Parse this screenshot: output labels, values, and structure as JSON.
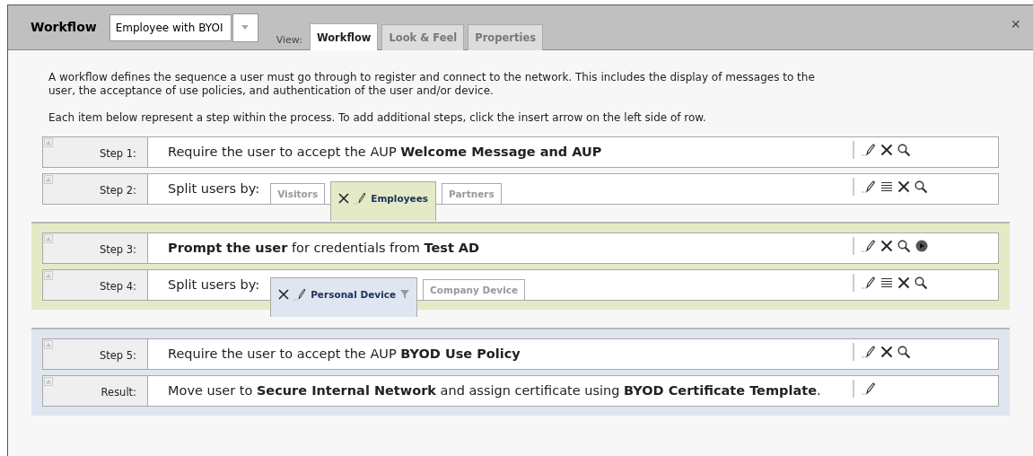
{
  "header": {
    "title": "Workflow",
    "workflow_select": {
      "value": "Employee with BYOI"
    },
    "view_label": "View:",
    "tabs": [
      {
        "label": "Workflow",
        "selected": true
      },
      {
        "label": "Look & Feel",
        "selected": false
      },
      {
        "label": "Properties",
        "selected": false
      }
    ],
    "close": "×"
  },
  "description": [
    "A workflow defines the sequence a user must go through to register and connect to the network. This includes the display of messages to the user, the acceptance of use policies, and authentication of the user and/or device.",
    "Each item below represent a step within the process. To add additional steps, click the insert arrow on the left side of row."
  ],
  "sections": [
    {
      "steps": [
        {
          "label": "Step 1:",
          "kind": "text",
          "text": "Require the user to accept the AUP **Welcome Message and AUP**",
          "actions": [
            {
              "kind": "edit"
            },
            {
              "kind": "delete"
            },
            {
              "kind": "view"
            }
          ]
        },
        {
          "label": "Step 2:",
          "kind": "split",
          "text": "Split users by:",
          "branches": [
            {
              "label": "Visitors",
              "selected": false
            },
            {
              "label": "Employees",
              "selected": true,
              "filter": false
            },
            {
              "label": "Partners",
              "selected": false
            }
          ],
          "actions": [
            {
              "kind": "edit"
            },
            {
              "kind": "list"
            },
            {
              "kind": "delete"
            },
            {
              "kind": "view"
            }
          ]
        }
      ]
    },
    {
      "color": "#e3ebc6",
      "steps": [
        {
          "label": "Step 3:",
          "kind": "text",
          "text": "**Prompt the user** for credentials from **Test AD**",
          "actions": [
            {
              "kind": "edit"
            },
            {
              "kind": "delete"
            },
            {
              "kind": "view"
            },
            {
              "kind": "play"
            }
          ]
        },
        {
          "label": "Step 4:",
          "kind": "split",
          "text": "Split users by:",
          "branches": [
            {
              "label": "Personal Device",
              "selected": true,
              "filter": true
            },
            {
              "label": "Company Device",
              "selected": false
            }
          ],
          "actions": [
            {
              "kind": "edit"
            },
            {
              "kind": "list"
            },
            {
              "kind": "delete"
            },
            {
              "kind": "view"
            }
          ]
        }
      ]
    },
    {
      "color": "#dfe6ef",
      "steps": [
        {
          "label": "Step 5:",
          "kind": "text",
          "text": "Require the user to accept the AUP **BYOD Use Policy**",
          "actions": [
            {
              "kind": "edit"
            },
            {
              "kind": "delete"
            },
            {
              "kind": "view"
            }
          ]
        },
        {
          "label": "Result:",
          "kind": "text",
          "text": "Move user to **Secure Internal Network** and assign certificate using **BYOD Certificate Template**.",
          "actions": [
            {
              "kind": "edit"
            }
          ]
        }
      ]
    }
  ]
}
